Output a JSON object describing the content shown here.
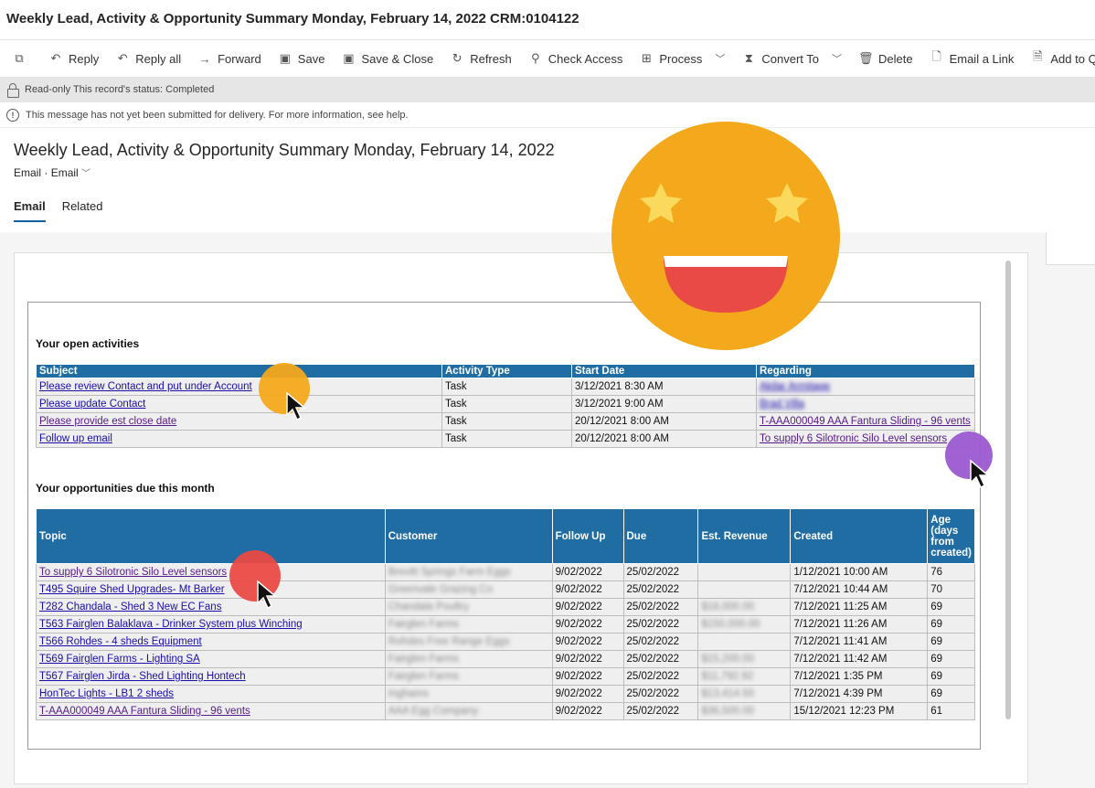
{
  "window_title": "Weekly Lead, Activity & Opportunity Summary Monday, February 14, 2022 CRM:0104122",
  "toolbar": [
    {
      "label": "",
      "icon": "popout-icon"
    },
    {
      "label": "Reply",
      "icon": "reply-icon"
    },
    {
      "label": "Reply all",
      "icon": "reply-all-icon"
    },
    {
      "label": "Forward",
      "icon": "forward-icon"
    },
    {
      "label": "Save",
      "icon": "save-icon"
    },
    {
      "label": "Save & Close",
      "icon": "save-close-icon"
    },
    {
      "label": "Refresh",
      "icon": "refresh-icon"
    },
    {
      "label": "Check Access",
      "icon": "check-access-icon"
    },
    {
      "label": "Process",
      "icon": "process-icon"
    },
    {
      "label": "Convert To",
      "icon": "convert-icon"
    },
    {
      "label": "Delete",
      "icon": "delete-icon"
    },
    {
      "label": "Email a Link",
      "icon": "email-link-icon"
    },
    {
      "label": "Add to Queue",
      "icon": "queue-icon"
    }
  ],
  "notices": {
    "readonly": "Read-only This record's status: Completed",
    "delivery": "This message has not yet been submitted for delivery. For more information, see help."
  },
  "record": {
    "title": "Weekly Lead, Activity & Opportunity Summary Monday, February 14, 2022",
    "entity": "Email",
    "form": "Email"
  },
  "tabs": [
    {
      "label": "Email",
      "active": true
    },
    {
      "label": "Related",
      "active": false
    }
  ],
  "activities": {
    "heading": "Your open activities",
    "columns": [
      "Subject",
      "Activity Type",
      "Start Date",
      "Regarding"
    ],
    "rows": [
      {
        "subject": "Please review Contact and put under Account",
        "type": "Task",
        "start": "3/12/2021 8:30 AM",
        "regarding": "Akilar Armitage",
        "regarding_blurred": true
      },
      {
        "subject": "Please update Contact",
        "type": "Task",
        "start": "3/12/2021 9:00 AM",
        "regarding": "Brad Villa",
        "regarding_blurred": true
      },
      {
        "subject": "Please provide est close date",
        "type": "Task",
        "start": "20/12/2021 8:00 AM",
        "regarding": "T-AAA000049 AAA Fantura Sliding - 96 vents",
        "regarding_blurred": false
      },
      {
        "subject": "Follow up email",
        "type": "Task",
        "start": "20/12/2021 8:00 AM",
        "regarding": "To supply 6 Silotronic Silo Level sensors",
        "regarding_blurred": false
      }
    ]
  },
  "opportunities": {
    "heading": "Your opportunities due this month",
    "columns": [
      "Topic",
      "Customer",
      "Follow Up",
      "Due",
      "Est. Revenue",
      "Created",
      "Age (days from created)"
    ],
    "rows": [
      {
        "topic": "To supply 6 Silotronic Silo Level sensors",
        "customer": "Brevitt Springs Farm Eggs",
        "follow": "9/02/2022",
        "due": "25/02/2022",
        "revenue": "",
        "created": "1/12/2021 10:00 AM",
        "age": "76"
      },
      {
        "topic": "T495 Squire Shed Upgrades- Mt Barker",
        "customer": "Greenvale Grazing Co",
        "follow": "9/02/2022",
        "due": "25/02/2022",
        "revenue": "",
        "created": "7/12/2021 10:44 AM",
        "age": "70"
      },
      {
        "topic": "T282 Chandala - Shed 3 New EC Fans",
        "customer": "Chandala Poultry",
        "follow": "9/02/2022",
        "due": "25/02/2022",
        "revenue": "$18,000.00",
        "created": "7/12/2021 11:25 AM",
        "age": "69"
      },
      {
        "topic": "T563 Fairglen Balaklava - Drinker System plus Winching",
        "customer": "Fairglen Farms",
        "follow": "9/02/2022",
        "due": "25/02/2022",
        "revenue": "$150,000.00",
        "created": "7/12/2021 11:26 AM",
        "age": "69"
      },
      {
        "topic": "T566 Rohdes - 4 sheds Equipment",
        "customer": "Rohdes Free Range Eggs",
        "follow": "9/02/2022",
        "due": "25/02/2022",
        "revenue": "",
        "created": "7/12/2021 11:41 AM",
        "age": "69"
      },
      {
        "topic": "T569 Fairglen Farms - Lighting SA",
        "customer": "Fairglen Farms",
        "follow": "9/02/2022",
        "due": "25/02/2022",
        "revenue": "$15,200.00",
        "created": "7/12/2021 11:42 AM",
        "age": "69"
      },
      {
        "topic": "T567 Fairglen Jirda - Shed Lighting Hontech",
        "customer": "Fairglen Farms",
        "follow": "9/02/2022",
        "due": "25/02/2022",
        "revenue": "$11,792.92",
        "created": "7/12/2021 1:35 PM",
        "age": "69"
      },
      {
        "topic": "HonTec Lights - LB1 2 sheds",
        "customer": "Inghams",
        "follow": "9/02/2022",
        "due": "25/02/2022",
        "revenue": "$13,414.50",
        "created": "7/12/2021 4:39 PM",
        "age": "69"
      },
      {
        "topic": "T-AAA000049 AAA Fantura Sliding - 96 vents",
        "customer": "AAA Egg Company",
        "follow": "9/02/2022",
        "due": "25/02/2022",
        "revenue": "$36,500.00",
        "created": "15/12/2021 12:23 PM",
        "age": "61"
      }
    ]
  },
  "colors": {
    "table_header": "#1f6da3",
    "link": "#1a0dab",
    "visited": "#551a8b",
    "emoji_face": "#F4A81B",
    "emoji_star": "#FAD95C",
    "emoji_mouth": "#E94A45",
    "cursor_orange": "#F4A81B",
    "cursor_purple": "#9B59D0",
    "cursor_red": "#E94A45"
  }
}
